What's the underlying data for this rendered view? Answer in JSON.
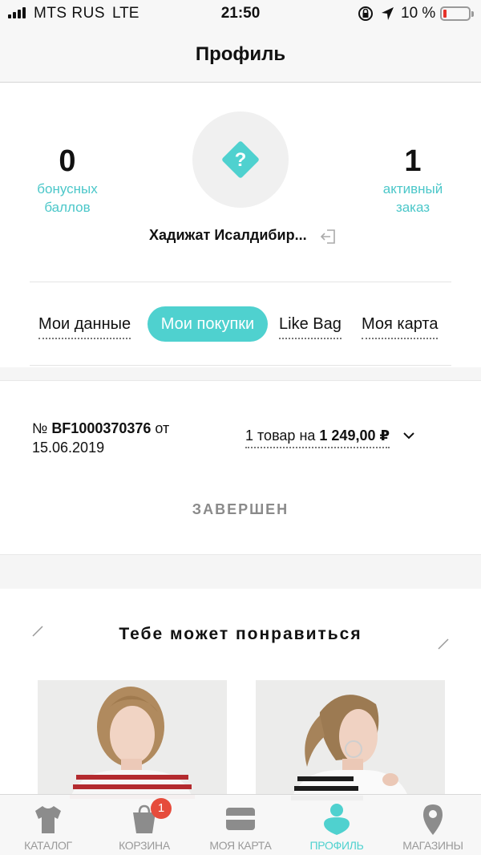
{
  "status_bar": {
    "carrier": "MTS RUS",
    "network": "LTE",
    "time": "21:50",
    "battery_percent": "10 %",
    "battery_level": 0.1
  },
  "header": {
    "title": "Профиль"
  },
  "profile": {
    "bonus_count": "0",
    "bonus_label_1": "бонусных",
    "bonus_label_2": "баллов",
    "orders_count": "1",
    "orders_label_1": "активный",
    "orders_label_2": "заказ",
    "avatar_symbol": "?",
    "user_name": "Хадижат Исалдибир..."
  },
  "tabs": [
    {
      "label": "Мои данные",
      "active": false
    },
    {
      "label": "Мои покупки",
      "active": true
    },
    {
      "label": "Like Bag",
      "active": false
    },
    {
      "label": "Моя карта",
      "active": false
    }
  ],
  "order": {
    "number_prefix": "№ ",
    "number": "BF1000370376",
    "number_suffix": " от",
    "date": "15.06.2019",
    "summary_prefix": "1 товар на ",
    "summary_amount": "1 249,00 ₽",
    "status": "ЗАВЕРШЕН"
  },
  "recommendations": {
    "title": "Тебе может понравиться"
  },
  "tab_bar": [
    {
      "label": "КАТАЛОГ",
      "icon": "shirt-icon",
      "active": false
    },
    {
      "label": "КОРЗИНА",
      "icon": "bag-icon",
      "active": false,
      "badge": "1"
    },
    {
      "label": "МОЯ КАРТА",
      "icon": "card-icon",
      "active": false
    },
    {
      "label": "ПРОФИЛЬ",
      "icon": "person-icon",
      "active": true
    },
    {
      "label": "МАГАЗИНЫ",
      "icon": "location-pin-icon",
      "active": false
    }
  ],
  "colors": {
    "accent": "#4fd1cf",
    "badge": "#e64c3c",
    "battery_low": "#e6332a"
  }
}
